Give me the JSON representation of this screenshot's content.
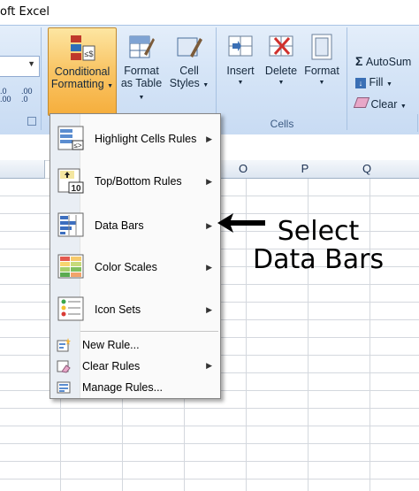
{
  "window": {
    "title": "oft Excel"
  },
  "ribbon": {
    "buttons": {
      "conditional_formatting": [
        "Conditional",
        "Formatting"
      ],
      "format_as_table": [
        "Format",
        "as Table"
      ],
      "cell_styles": [
        "Cell",
        "Styles"
      ],
      "insert": "Insert",
      "delete": "Delete",
      "format": "Format",
      "autosum": "AutoSum",
      "fill": "Fill",
      "clear": "Clear",
      "inc_decimal": ".0\n.00",
      "dec_decimal": ".00\n.0"
    },
    "groups": {
      "cells": "Cells"
    }
  },
  "columns": [
    "O",
    "P",
    "Q"
  ],
  "menu": {
    "items": [
      {
        "label": "Highlight Cells Rules",
        "icon": "highlight-cells-icon",
        "submenu": true
      },
      {
        "label": "Top/Bottom Rules",
        "icon": "top-bottom-icon",
        "submenu": true
      },
      {
        "label": "Data Bars",
        "icon": "data-bars-icon",
        "submenu": true
      },
      {
        "label": "Color Scales",
        "icon": "color-scales-icon",
        "submenu": true
      },
      {
        "label": "Icon Sets",
        "icon": "icon-sets-icon",
        "submenu": true
      }
    ],
    "small_items": [
      {
        "label": "New Rule...",
        "icon": "new-rule-icon",
        "submenu": false
      },
      {
        "label": "Clear Rules",
        "icon": "clear-rules-icon",
        "submenu": true
      },
      {
        "label": "Manage Rules...",
        "icon": "manage-rules-icon",
        "submenu": false
      }
    ]
  },
  "annotation": {
    "line1": "Select",
    "line2": "Data Bars"
  },
  "colors": {
    "menu_highlight": "#f6ae3c",
    "ribbon": "#d6e5f7"
  }
}
